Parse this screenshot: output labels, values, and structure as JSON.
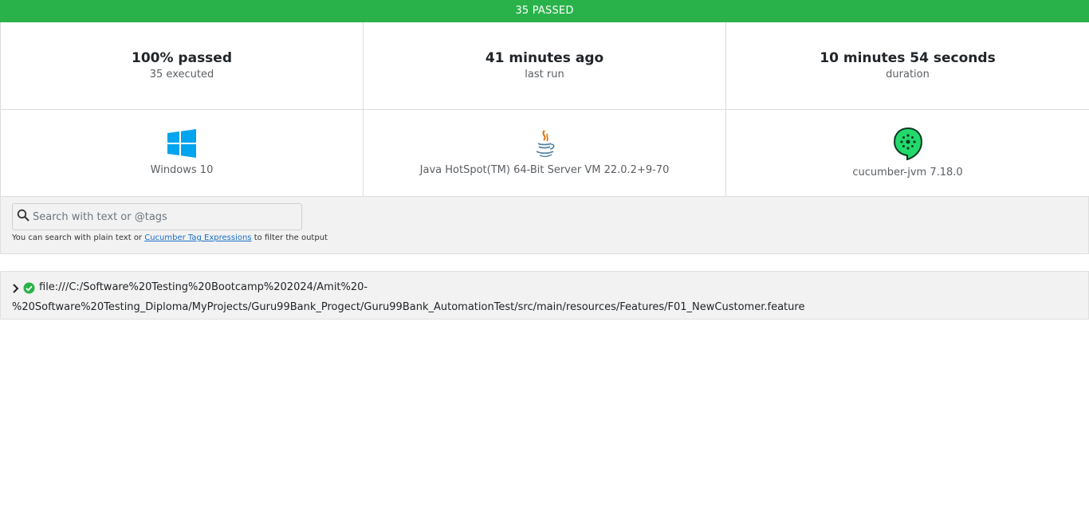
{
  "status": {
    "text": "35 PASSED",
    "color": "#2ab24a"
  },
  "metrics": [
    {
      "value": "100% passed",
      "label": "35 executed"
    },
    {
      "value": "41 minutes ago",
      "label": "last run"
    },
    {
      "value": "10 minutes 54 seconds",
      "label": "duration"
    }
  ],
  "environment": [
    {
      "icon": "windows-icon",
      "label": "Windows 10"
    },
    {
      "icon": "java-icon",
      "label": "Java HotSpot(TM) 64-Bit Server VM 22.0.2+9-70"
    },
    {
      "icon": "cucumber-icon",
      "label": "cucumber-jvm 7.18.0"
    }
  ],
  "search": {
    "placeholder": "Search with text or @tags",
    "help_prefix": "You can search with plain text or",
    "help_link": "Cucumber Tag Expressions",
    "help_suffix": "to filter the output"
  },
  "feature": {
    "status_icon": "passed-check-icon",
    "path_line1": "file:///C:/Software%20Testing%20Bootcamp%202024/Amit%20-",
    "path_line2": "%20Software%20Testing_Diploma/MyProjects/Guru99Bank_Progect/Guru99Bank_AutomationTest/src/main/resources/Features/F01_NewCustomer.feature"
  }
}
